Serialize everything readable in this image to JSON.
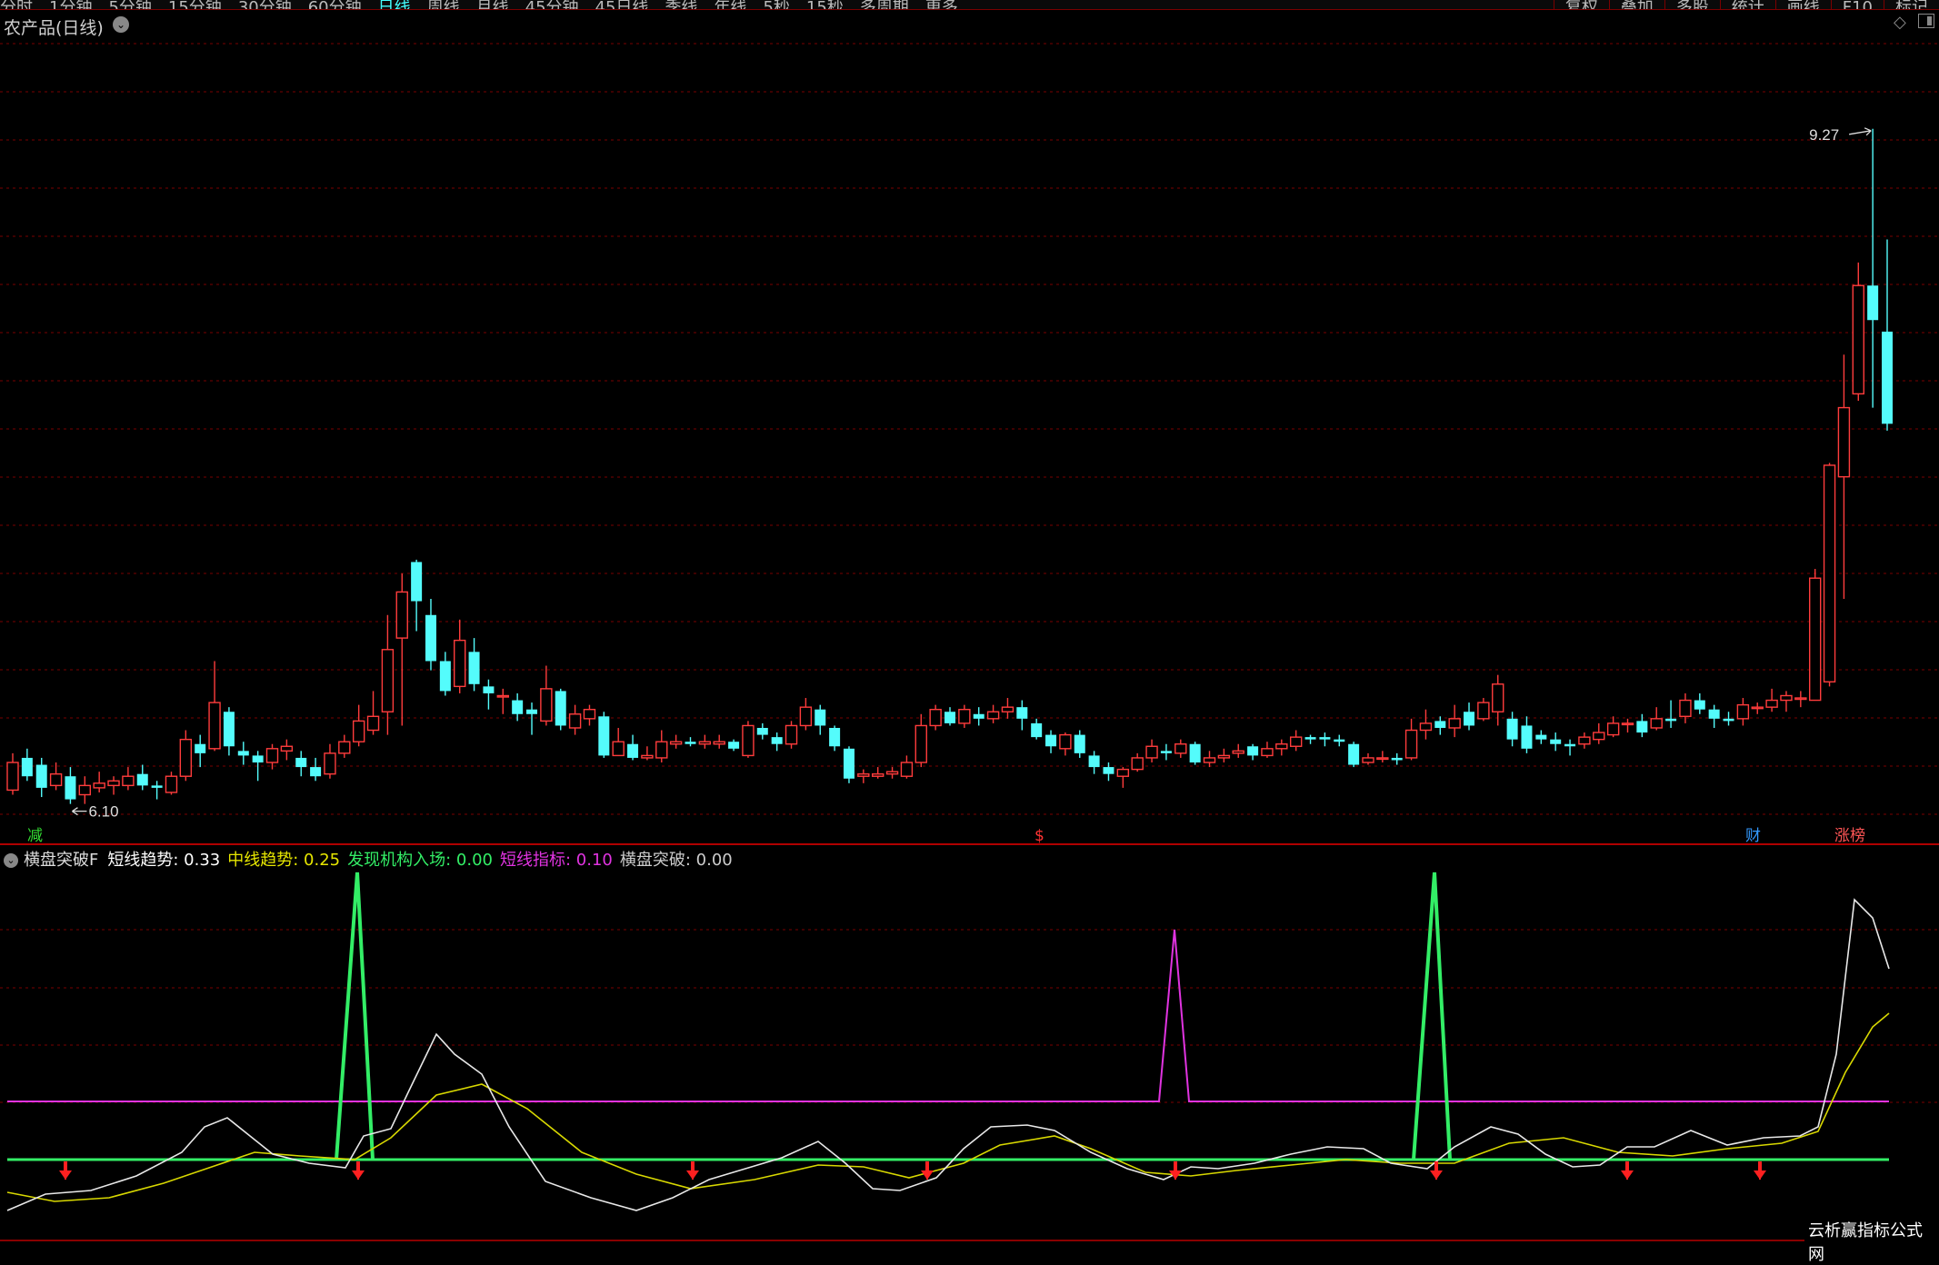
{
  "toolbar": {
    "periods": [
      "分时",
      "1分钟",
      "5分钟",
      "15分钟",
      "30分钟",
      "60分钟",
      "日线",
      "周线",
      "月线",
      "45分钟",
      "45日线",
      "季线",
      "年线",
      "5秒",
      "15秒",
      "多周期",
      "更多"
    ],
    "active_period": "日线",
    "right_buttons": [
      "复权",
      "叠加",
      "多股",
      "统计",
      "画线",
      "F10",
      "标记"
    ]
  },
  "main_chart": {
    "title": "农产品(日线)",
    "max_label": "9.27",
    "min_label": "6.10",
    "markers": [
      {
        "text": "减",
        "color": "#33dd33"
      },
      {
        "text": "$",
        "color": "#ff3333"
      },
      {
        "text": "财",
        "color": "#3399ff"
      },
      {
        "text": "涨榜",
        "color": "#ff5555"
      }
    ]
  },
  "indicator": {
    "title": "横盘突破F",
    "items": [
      {
        "label": "短线趋势",
        "value": "0.33",
        "color": "#ffffff"
      },
      {
        "label": "中线趋势",
        "value": "0.25",
        "color": "#e6e600"
      },
      {
        "label": "发现机构入场",
        "value": "0.00",
        "color": "#33ee66"
      },
      {
        "label": "短线指标",
        "value": "0.10",
        "color": "#e033e0"
      },
      {
        "label": "横盘突破",
        "value": "0.00",
        "color": "#cccccc"
      }
    ]
  },
  "colors": {
    "up": "#ff3c3c",
    "down": "#54fcfc",
    "grid": "#7a0000"
  },
  "watermark": "云析赢指标公式网",
  "chart_data": {
    "type": "candlestick",
    "ylim": [
      6.0,
      9.4
    ],
    "candles": [
      [
        6.16,
        6.28,
        6.32,
        6.14
      ],
      [
        6.3,
        6.22,
        6.34,
        6.2
      ],
      [
        6.27,
        6.17,
        6.3,
        6.13
      ],
      [
        6.18,
        6.23,
        6.28,
        6.16
      ],
      [
        6.22,
        6.12,
        6.26,
        6.1
      ],
      [
        6.14,
        6.18,
        6.22,
        6.1
      ],
      [
        6.17,
        6.19,
        6.24,
        6.15
      ],
      [
        6.18,
        6.2,
        6.22,
        6.14
      ],
      [
        6.18,
        6.22,
        6.26,
        6.16
      ],
      [
        6.23,
        6.18,
        6.27,
        6.16
      ],
      [
        6.18,
        6.17,
        6.2,
        6.12
      ],
      [
        6.15,
        6.22,
        6.24,
        6.14
      ],
      [
        6.22,
        6.38,
        6.42,
        6.2
      ],
      [
        6.36,
        6.32,
        6.4,
        6.26
      ],
      [
        6.34,
        6.54,
        6.72,
        6.33
      ],
      [
        6.5,
        6.35,
        6.52,
        6.31
      ],
      [
        6.33,
        6.31,
        6.37,
        6.27
      ],
      [
        6.31,
        6.28,
        6.33,
        6.2
      ],
      [
        6.28,
        6.34,
        6.36,
        6.25
      ],
      [
        6.33,
        6.35,
        6.38,
        6.29
      ],
      [
        6.3,
        6.26,
        6.33,
        6.22
      ],
      [
        6.26,
        6.22,
        6.3,
        6.2
      ],
      [
        6.23,
        6.32,
        6.36,
        6.21
      ],
      [
        6.32,
        6.37,
        6.4,
        6.3
      ],
      [
        6.37,
        6.46,
        6.53,
        6.35
      ],
      [
        6.42,
        6.48,
        6.59,
        6.4
      ],
      [
        6.5,
        6.77,
        6.92,
        6.4
      ],
      [
        6.82,
        7.02,
        7.1,
        6.44
      ],
      [
        7.15,
        6.98,
        7.16,
        6.85
      ],
      [
        6.92,
        6.72,
        6.99,
        6.68
      ],
      [
        6.72,
        6.59,
        6.76,
        6.57
      ],
      [
        6.61,
        6.81,
        6.9,
        6.58
      ],
      [
        6.76,
        6.62,
        6.82,
        6.59
      ],
      [
        6.61,
        6.58,
        6.64,
        6.51
      ],
      [
        6.57,
        6.57,
        6.6,
        6.49
      ],
      [
        6.55,
        6.49,
        6.58,
        6.46
      ],
      [
        6.51,
        6.49,
        6.54,
        6.4
      ],
      [
        6.46,
        6.6,
        6.7,
        6.44
      ],
      [
        6.59,
        6.44,
        6.6,
        6.42
      ],
      [
        6.43,
        6.49,
        6.53,
        6.4
      ],
      [
        6.47,
        6.51,
        6.53,
        6.44
      ],
      [
        6.48,
        6.31,
        6.5,
        6.3
      ],
      [
        6.31,
        6.37,
        6.43,
        6.31
      ],
      [
        6.36,
        6.3,
        6.4,
        6.29
      ],
      [
        6.3,
        6.31,
        6.35,
        6.29
      ],
      [
        6.3,
        6.37,
        6.42,
        6.28
      ],
      [
        6.36,
        6.37,
        6.4,
        6.34
      ],
      [
        6.37,
        6.36,
        6.39,
        6.35
      ],
      [
        6.36,
        6.37,
        6.4,
        6.34
      ],
      [
        6.36,
        6.37,
        6.4,
        6.34
      ],
      [
        6.37,
        6.34,
        6.38,
        6.33
      ],
      [
        6.31,
        6.44,
        6.46,
        6.3
      ],
      [
        6.43,
        6.4,
        6.45,
        6.38
      ],
      [
        6.39,
        6.36,
        6.41,
        6.33
      ],
      [
        6.36,
        6.44,
        6.46,
        6.34
      ],
      [
        6.44,
        6.52,
        6.56,
        6.42
      ],
      [
        6.51,
        6.44,
        6.53,
        6.4
      ],
      [
        6.43,
        6.35,
        6.44,
        6.33
      ],
      [
        6.34,
        6.21,
        6.35,
        6.19
      ],
      [
        6.22,
        6.23,
        6.25,
        6.19
      ],
      [
        6.22,
        6.23,
        6.26,
        6.21
      ],
      [
        6.23,
        6.24,
        6.26,
        6.21
      ],
      [
        6.22,
        6.28,
        6.31,
        6.21
      ],
      [
        6.28,
        6.44,
        6.49,
        6.26
      ],
      [
        6.44,
        6.51,
        6.53,
        6.42
      ],
      [
        6.5,
        6.45,
        6.52,
        6.44
      ],
      [
        6.45,
        6.51,
        6.53,
        6.43
      ],
      [
        6.49,
        6.47,
        6.52,
        6.44
      ],
      [
        6.47,
        6.5,
        6.53,
        6.45
      ],
      [
        6.5,
        6.52,
        6.56,
        6.47
      ],
      [
        6.52,
        6.47,
        6.55,
        6.42
      ],
      [
        6.45,
        6.39,
        6.47,
        6.38
      ],
      [
        6.4,
        6.35,
        6.42,
        6.32
      ],
      [
        6.34,
        6.4,
        6.41,
        6.31
      ],
      [
        6.4,
        6.32,
        6.42,
        6.3
      ],
      [
        6.31,
        6.26,
        6.33,
        6.23
      ],
      [
        6.26,
        6.23,
        6.28,
        6.2
      ],
      [
        6.22,
        6.25,
        6.26,
        6.17
      ],
      [
        6.25,
        6.3,
        6.32,
        6.24
      ],
      [
        6.3,
        6.35,
        6.38,
        6.28
      ],
      [
        6.33,
        6.32,
        6.36,
        6.29
      ],
      [
        6.32,
        6.36,
        6.38,
        6.3
      ],
      [
        6.36,
        6.28,
        6.37,
        6.27
      ],
      [
        6.28,
        6.3,
        6.33,
        6.26
      ],
      [
        6.3,
        6.31,
        6.34,
        6.28
      ],
      [
        6.32,
        6.33,
        6.36,
        6.3
      ],
      [
        6.35,
        6.31,
        6.36,
        6.29
      ],
      [
        6.31,
        6.34,
        6.37,
        6.3
      ],
      [
        6.34,
        6.36,
        6.38,
        6.31
      ],
      [
        6.35,
        6.39,
        6.42,
        6.33
      ],
      [
        6.39,
        6.38,
        6.4,
        6.36
      ],
      [
        6.39,
        6.38,
        6.41,
        6.35
      ],
      [
        6.38,
        6.37,
        6.4,
        6.35
      ],
      [
        6.36,
        6.27,
        6.37,
        6.26
      ],
      [
        6.28,
        6.3,
        6.32,
        6.27
      ],
      [
        6.3,
        6.3,
        6.33,
        6.28
      ],
      [
        6.3,
        6.29,
        6.32,
        6.27
      ],
      [
        6.3,
        6.42,
        6.47,
        6.29
      ],
      [
        6.42,
        6.45,
        6.51,
        6.38
      ],
      [
        6.46,
        6.43,
        6.48,
        6.4
      ],
      [
        6.43,
        6.47,
        6.53,
        6.39
      ],
      [
        6.5,
        6.44,
        6.54,
        6.42
      ],
      [
        6.47,
        6.54,
        6.56,
        6.46
      ],
      [
        6.5,
        6.62,
        6.66,
        6.44
      ],
      [
        6.47,
        6.38,
        6.5,
        6.35
      ],
      [
        6.44,
        6.34,
        6.48,
        6.32
      ],
      [
        6.4,
        6.38,
        6.42,
        6.36
      ],
      [
        6.38,
        6.36,
        6.41,
        6.33
      ],
      [
        6.36,
        6.35,
        6.38,
        6.31
      ],
      [
        6.36,
        6.39,
        6.41,
        6.34
      ],
      [
        6.38,
        6.41,
        6.45,
        6.36
      ],
      [
        6.4,
        6.45,
        6.48,
        6.39
      ],
      [
        6.45,
        6.45,
        6.47,
        6.41
      ],
      [
        6.46,
        6.41,
        6.49,
        6.39
      ],
      [
        6.43,
        6.47,
        6.52,
        6.42
      ],
      [
        6.47,
        6.46,
        6.55,
        6.43
      ],
      [
        6.48,
        6.55,
        6.58,
        6.45
      ],
      [
        6.55,
        6.51,
        6.58,
        6.49
      ],
      [
        6.51,
        6.47,
        6.53,
        6.43
      ],
      [
        6.47,
        6.46,
        6.5,
        6.44
      ],
      [
        6.47,
        6.53,
        6.56,
        6.44
      ],
      [
        6.52,
        6.52,
        6.54,
        6.49
      ],
      [
        6.52,
        6.55,
        6.6,
        6.5
      ],
      [
        6.55,
        6.57,
        6.59,
        6.5
      ],
      [
        6.56,
        6.56,
        6.59,
        6.52
      ],
      [
        6.55,
        7.08,
        7.12,
        6.62
      ],
      [
        6.63,
        7.57,
        7.58,
        6.61
      ],
      [
        7.52,
        7.82,
        8.05,
        6.99
      ],
      [
        7.88,
        8.35,
        8.45,
        7.85
      ],
      [
        8.35,
        8.2,
        9.03,
        7.82
      ],
      [
        8.15,
        7.75,
        8.55,
        7.72
      ]
    ]
  }
}
